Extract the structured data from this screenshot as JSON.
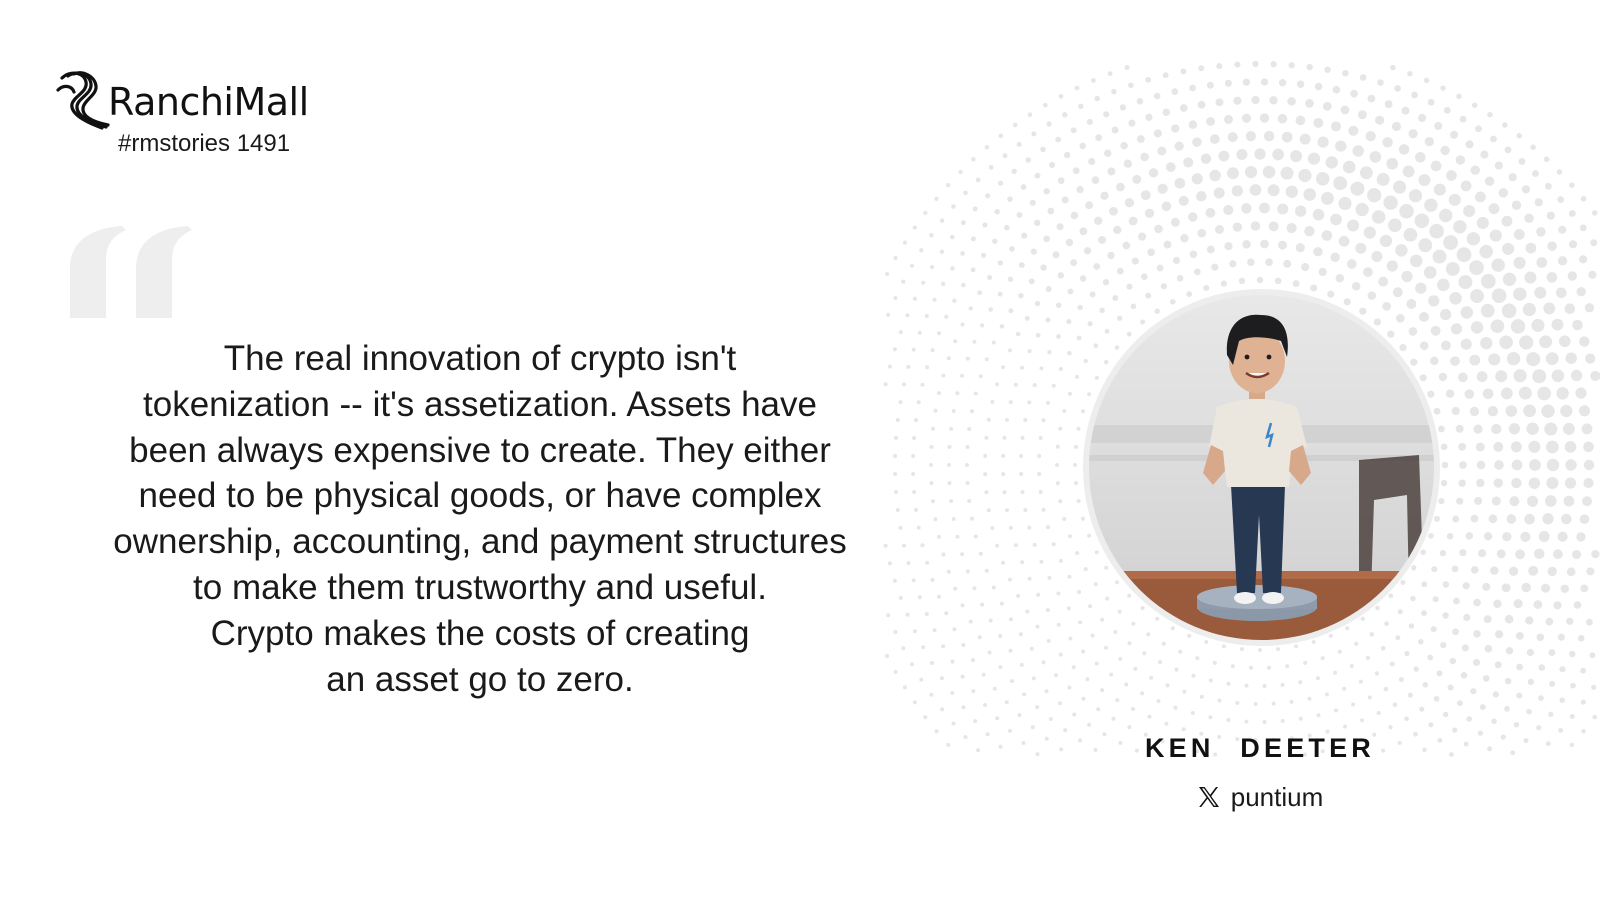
{
  "brand": {
    "name": "RanchiMall",
    "tag": "#rmstories 1491",
    "logo_icon": "ranchimall-swirl-icon"
  },
  "quote": {
    "mark_icon": "open-quote-icon",
    "lines": [
      "The real innovation of crypto isn't",
      "tokenization -- it's assetization. Assets have",
      "been always expensive to create. They either",
      "need to be physical goods, or have complex",
      "ownership, accounting, and payment structures",
      "to make them trustworthy and useful.",
      "Crypto makes the costs of creating",
      "an asset go to zero."
    ]
  },
  "author": {
    "name": "KEN DEETER",
    "handle": "puntium",
    "social_icon": "x-logo-icon",
    "photo": "author-photo"
  },
  "colors": {
    "background": "#ffffff",
    "text": "#1a1a1a",
    "quote_mark": "#eeeeee",
    "dots": "#e6e6e6"
  }
}
